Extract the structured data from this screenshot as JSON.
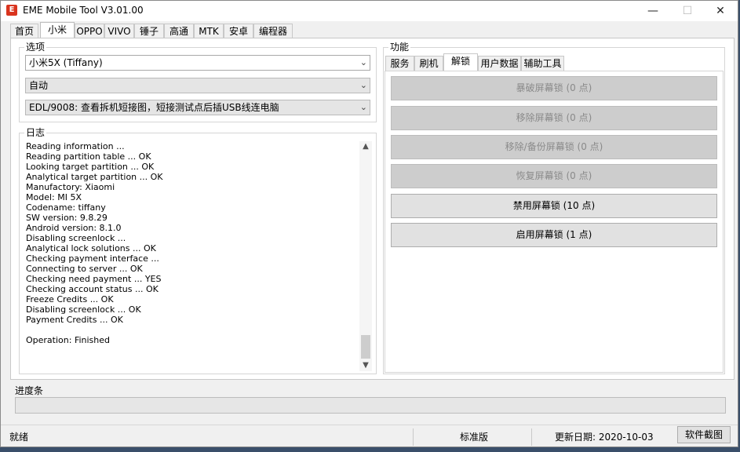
{
  "window": {
    "title": "EME Mobile Tool V3.01.00",
    "app_icon": "E"
  },
  "window_controls": {
    "minimize": "—",
    "maximize": "☐",
    "close": "✕"
  },
  "main_tabs": [
    "首页",
    "小米",
    "OPPO",
    "VIVO",
    "锤子",
    "高通",
    "MTK",
    "安卓",
    "编程器"
  ],
  "active_main_tab": "小米",
  "options": {
    "label": "选项",
    "device": "小米5X (Tiffany)",
    "mode": "自动",
    "connection": "EDL/9008: 查看拆机短接图，短接测试点后插USB线连电脑"
  },
  "log": {
    "label": "日志",
    "lines": [
      "Reading information ...",
      "Reading partition table ... OK",
      "Looking target partition ... OK",
      "Analytical target partition ... OK",
      "Manufactory: Xiaomi",
      "Model: MI 5X",
      "Codename: tiffany",
      "SW version: 9.8.29",
      "Android version: 8.1.0",
      "Disabling screenlock ...",
      "Analytical lock solutions ... OK",
      "Checking payment interface ...",
      "Connecting to server ... OK",
      "Checking need payment ... YES",
      "Checking account status ... OK",
      "Freeze Credits ... OK",
      "Disabling screenlock ... OK",
      "Payment Credits ... OK",
      "",
      "Operation: Finished"
    ]
  },
  "function": {
    "label": "功能",
    "tabs": [
      "服务",
      "刷机",
      "解锁",
      "用户数据",
      "辅助工具"
    ],
    "active_tab": "解锁",
    "buttons": [
      {
        "label": "暴破屏幕锁 (0 点)",
        "enabled": false
      },
      {
        "label": "移除屏幕锁 (0 点)",
        "enabled": false
      },
      {
        "label": "移除/备份屏幕锁 (0 点)",
        "enabled": false
      },
      {
        "label": "恢复屏幕锁 (0 点)",
        "enabled": false
      },
      {
        "label": "禁用屏幕锁 (10 点)",
        "enabled": true
      },
      {
        "label": "启用屏幕锁 (1 点)",
        "enabled": true
      }
    ]
  },
  "progress": {
    "label": "进度条",
    "value": 0
  },
  "status": {
    "state": "就绪",
    "edition": "标准版",
    "update_date": "更新日期: 2020-10-03",
    "screenshot_button": "软件截图"
  }
}
